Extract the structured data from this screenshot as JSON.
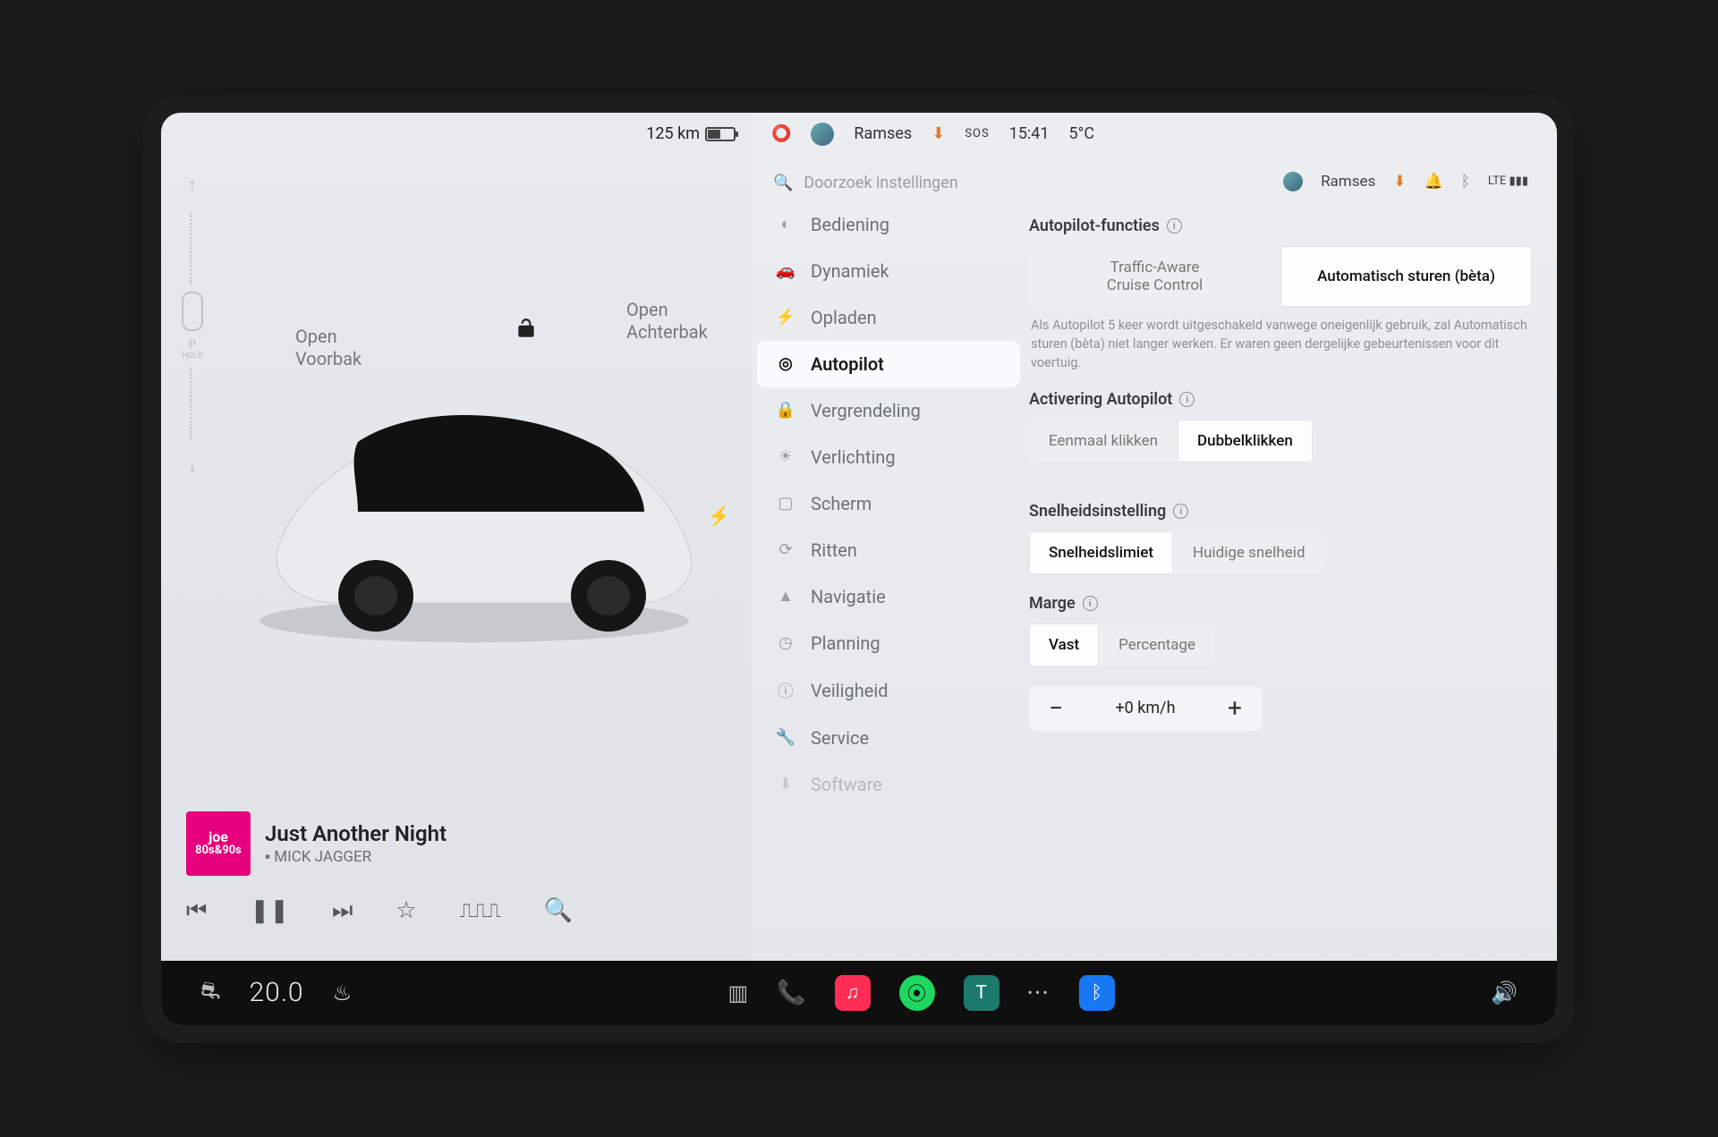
{
  "topStatus": {
    "range": "125 km"
  },
  "globalStatus": {
    "profile": "Ramses",
    "time": "15:41",
    "temp": "5°C",
    "sos": "SOS"
  },
  "frunk": {
    "line1": "Open",
    "line2": "Voorbak"
  },
  "trunk": {
    "line1": "Open",
    "line2": "Achterbak"
  },
  "search": {
    "placeholder": "Doorzoek instellingen"
  },
  "sidebar": {
    "items": [
      {
        "label": "Bediening"
      },
      {
        "label": "Dynamiek"
      },
      {
        "label": "Opladen"
      },
      {
        "label": "Autopilot"
      },
      {
        "label": "Vergrendeling"
      },
      {
        "label": "Verlichting"
      },
      {
        "label": "Scherm"
      },
      {
        "label": "Ritten"
      },
      {
        "label": "Navigatie"
      },
      {
        "label": "Planning"
      },
      {
        "label": "Veiligheid"
      },
      {
        "label": "Service"
      },
      {
        "label": "Software"
      }
    ]
  },
  "miniStatus": {
    "profile": "Ramses"
  },
  "media": {
    "stationTop": "joe",
    "stationBottom": "80s&90s",
    "title": "Just Another Night",
    "artist": "MICK JAGGER"
  },
  "detail": {
    "autopilotFuncTitle": "Autopilot-functies",
    "tacc": "Traffic-Aware\nCruise Control",
    "autosteer": "Automatisch sturen (bèta)",
    "helper": "Als Autopilot 5 keer wordt uitgeschakeld vanwege oneigenlijk gebruik, zal Automatisch sturen (bèta) niet langer werken. Er waren geen dergelijke gebeurtenissen voor dit voertuig.",
    "activationTitle": "Activering Autopilot",
    "singleClick": "Eenmaal klikken",
    "doubleClick": "Dubbelklikken",
    "speedTitle": "Snelheidsinstelling",
    "speedLimit": "Snelheidslimiet",
    "currentSpeed": "Huidige snelheid",
    "marginTitle": "Marge",
    "fixed": "Vast",
    "percentage": "Percentage",
    "offset": "+0 km/h"
  },
  "dock": {
    "temp": "20.0",
    "parkLabel": "HOLD",
    "parkLetter": "P"
  }
}
